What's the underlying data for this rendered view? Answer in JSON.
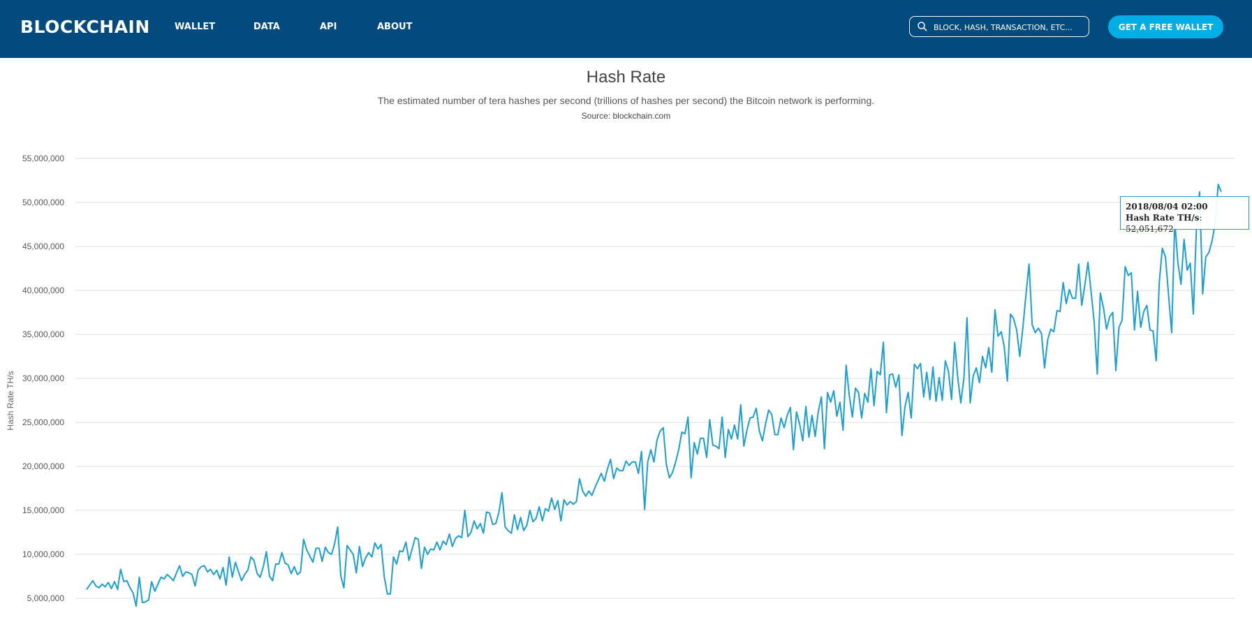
{
  "header": {
    "logo": "BLOCKCHAIN",
    "nav": [
      "WALLET",
      "DATA",
      "API",
      "ABOUT"
    ],
    "search_placeholder": "BLOCK, HASH, TRANSACTION, ETC...",
    "cta_label": "GET A FREE WALLET",
    "colors": {
      "bar": "#034a7f",
      "cta": "#00aee6"
    },
    "icons": [
      "search-icon"
    ]
  },
  "page": {
    "title": "Hash Rate",
    "subtitle": "The estimated number of tera hashes per second (trillions of hashes per second) the Bitcoin network is performing.",
    "source": "Source: blockchain.com"
  },
  "tooltip": {
    "date": "2018/08/04 02:00",
    "label": "Hash Rate TH/s",
    "value": "52,051,672"
  },
  "chart_data": {
    "type": "line",
    "title": "Hash Rate",
    "ylabel": "Hash Rate TH/s",
    "xlabel": "",
    "ylim": [
      4000000,
      55000000
    ],
    "y_ticks": [
      5000000,
      10000000,
      15000000,
      20000000,
      25000000,
      30000000,
      35000000,
      40000000,
      45000000,
      50000000,
      55000000
    ],
    "y_tick_labels": [
      "5,000,000",
      "10,000,000",
      "15,000,000",
      "20,000,000",
      "25,000,000",
      "30,000,000",
      "35,000,000",
      "40,000,000",
      "45,000,000",
      "50,000,000",
      "55,000,000"
    ],
    "grid": true,
    "line_color": "#1a9fd4",
    "series": [
      {
        "name": "Hash Rate TH/s",
        "values": [
          6000000,
          6500000,
          7000000,
          6400000,
          6200000,
          6600000,
          6300000,
          6800000,
          6100000,
          6900000,
          6000000,
          8300000,
          6900000,
          7000000,
          6200000,
          5600000,
          4100000,
          7400000,
          4500000,
          4600000,
          4800000,
          6900000,
          5800000,
          6600000,
          7400000,
          7200000,
          7700000,
          7400000,
          7000000,
          7900000,
          8700000,
          7500000,
          8000000,
          7900000,
          7700000,
          6400000,
          8200000,
          8600000,
          8700000,
          8000000,
          8300000,
          7700000,
          8200000,
          7200000,
          8500000,
          6500000,
          9700000,
          7400000,
          9100000,
          8000000,
          7000000,
          7700000,
          8200000,
          9700000,
          9300000,
          7800000,
          7400000,
          8600000,
          10300000,
          7500000,
          7000000,
          8900000,
          8900000,
          10200000,
          9000000,
          8800000,
          7800000,
          8600000,
          7700000,
          8000000,
          11700000,
          10500000,
          9800000,
          9100000,
          10700000,
          10700000,
          9200000,
          10800000,
          10200000,
          10000000,
          11200000,
          13100000,
          7500000,
          6200000,
          11000000,
          10500000,
          10000000,
          7900000,
          10900000,
          8600000,
          9600000,
          10200000,
          9700000,
          11300000,
          10600000,
          11100000,
          7500000,
          5500000,
          5500000,
          9700000,
          8900000,
          10400000,
          10300000,
          11400000,
          9300000,
          10600000,
          11900000,
          11700000,
          8400000,
          10800000,
          10000000,
          10600000,
          10500000,
          11400000,
          10500000,
          11500000,
          11100000,
          12300000,
          10900000,
          11800000,
          12100000,
          11900000,
          15000000,
          12000000,
          12500000,
          13800000,
          12900000,
          13500000,
          12400000,
          14800000,
          14700000,
          13400000,
          13500000,
          14800000,
          17000000,
          13100000,
          12700000,
          12400000,
          14500000,
          12800000,
          14200000,
          12700000,
          13300000,
          15000000,
          13700000,
          14100000,
          15400000,
          13800000,
          15200000,
          14900000,
          16400000,
          15100000,
          16100000,
          13800000,
          16200000,
          15600000,
          16000000,
          15700000,
          16000000,
          18600000,
          17200000,
          16600000,
          17200000,
          16700000,
          17600000,
          18400000,
          19200000,
          18300000,
          19700000,
          20800000,
          18600000,
          19800000,
          19500000,
          19500000,
          20600000,
          20100000,
          20500000,
          20500000,
          19200000,
          21700000,
          15100000,
          20500000,
          21900000,
          20500000,
          23000000,
          24000000,
          24400000,
          20200000,
          18700000,
          19300000,
          20500000,
          21900000,
          23900000,
          23700000,
          25600000,
          18700000,
          22700000,
          21400000,
          23200000,
          23200000,
          21000000,
          25300000,
          22400000,
          22300000,
          22000000,
          25600000,
          21000000,
          24200000,
          23100000,
          24700000,
          23100000,
          27000000,
          22300000,
          24100000,
          25500000,
          25600000,
          26600000,
          24000000,
          22900000,
          24800000,
          26400000,
          25900000,
          23600000,
          23600000,
          25500000,
          24400000,
          25800000,
          26700000,
          21900000,
          26200000,
          24800000,
          22900000,
          26800000,
          23300000,
          25800000,
          23400000,
          26200000,
          27900000,
          22000000,
          28400000,
          27300000,
          28600000,
          25700000,
          27300000,
          24100000,
          31500000,
          28100000,
          25600000,
          28900000,
          28400000,
          25500000,
          28300000,
          27300000,
          31100000,
          26900000,
          30800000,
          30400000,
          34100000,
          26100000,
          30400000,
          30500000,
          29000000,
          30400000,
          23500000,
          26800000,
          28400000,
          25500000,
          31600000,
          31100000,
          31700000,
          27900000,
          30700000,
          27600000,
          31300000,
          27400000,
          30100000,
          27500000,
          32000000,
          30800000,
          27600000,
          34100000,
          30100000,
          27200000,
          30100000,
          36900000,
          27200000,
          30300000,
          31200000,
          29500000,
          32500000,
          31200000,
          33500000,
          30700000,
          37800000,
          34800000,
          35300000,
          33600000,
          29700000,
          37300000,
          36800000,
          35500000,
          32500000,
          35700000,
          39500000,
          43000000,
          36100000,
          35200000,
          35700000,
          35100000,
          31200000,
          34400000,
          35600000,
          35300000,
          37700000,
          37600000,
          40900000,
          38500000,
          40100000,
          39100000,
          39100000,
          43000000,
          38300000,
          40600000,
          43200000,
          39900000,
          36400000,
          30500000,
          39700000,
          38000000,
          35600000,
          37000000,
          37500000,
          30900000,
          35800000,
          36600000,
          42700000,
          41700000,
          42000000,
          35500000,
          39900000,
          35800000,
          37600000,
          38300000,
          35500000,
          35400000,
          32000000,
          40900000,
          44800000,
          43800000,
          39500000,
          35200000,
          47900000,
          43200000,
          40700000,
          45800000,
          42300000,
          43100000,
          37300000,
          47300000,
          51200000,
          39600000,
          43800000,
          44300000,
          45600000,
          47500000,
          52051672,
          51200000
        ]
      }
    ]
  }
}
